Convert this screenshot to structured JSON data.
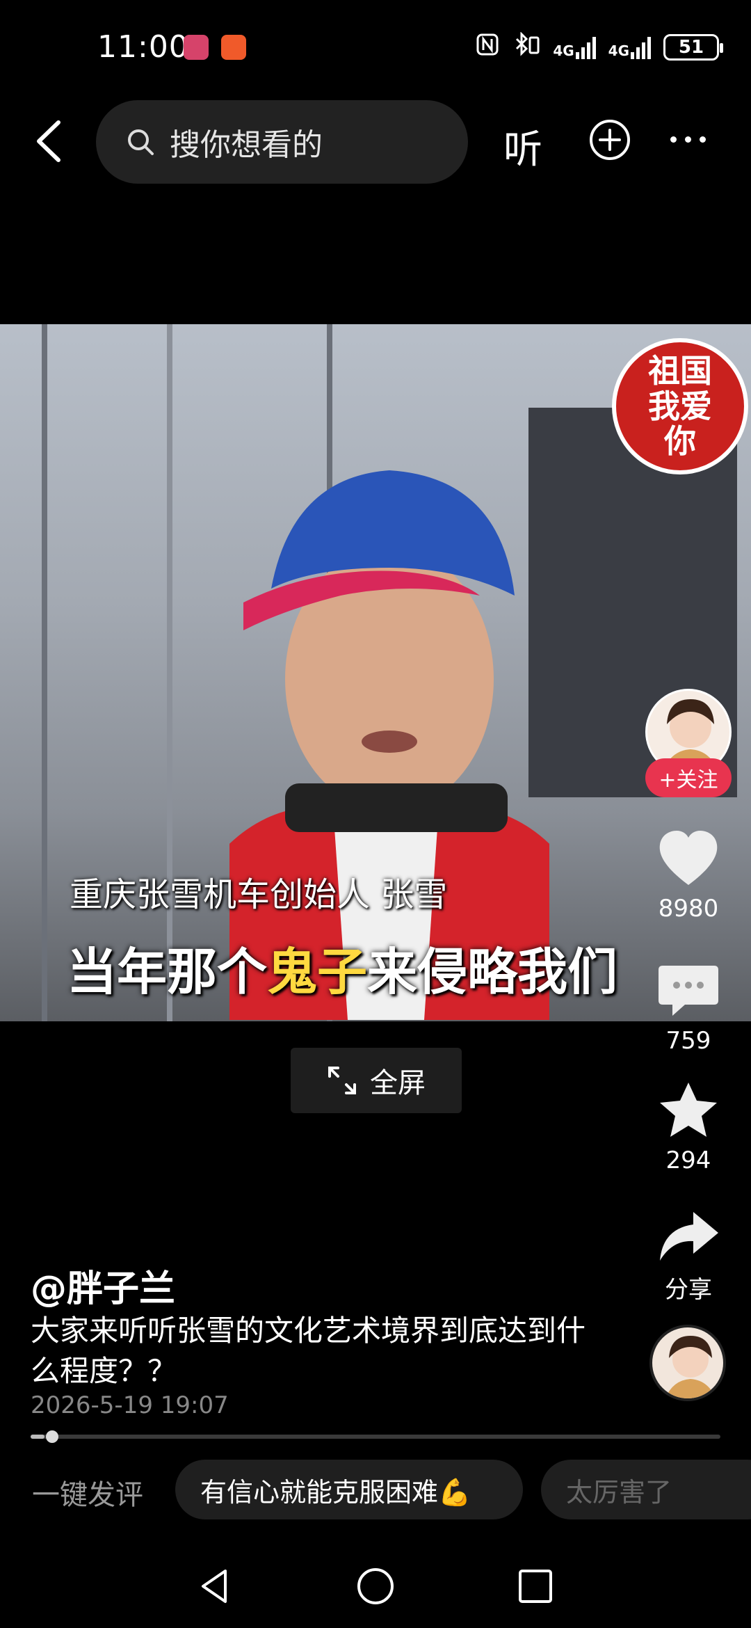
{
  "status_bar": {
    "time": "11:00",
    "network_1": "4G",
    "network_2": "4G",
    "battery": "51"
  },
  "top_nav": {
    "search_placeholder": "搜你想看的",
    "listen_label": "听"
  },
  "video": {
    "stamp_text": "祖国我爱你",
    "caption_name": "重庆张雪机车创始人 张雪",
    "caption_main_before": "当年那个",
    "caption_main_highlight": "鬼子",
    "caption_main_after": "来侵略我们",
    "highlight_color": "#ffd940"
  },
  "fullscreen_label": "全屏",
  "rail": {
    "follow_label": "+关注",
    "likes": "8980",
    "comments": "759",
    "favorites": "294",
    "share_label": "分享"
  },
  "post": {
    "author": "@胖子兰",
    "description": "大家来听听张雪的文化艺术境界到底达到什么程度？？",
    "date": "2026-5-19 19:07",
    "progress": 0.02
  },
  "quick_comment": {
    "label": "一键发评",
    "chips": [
      "有信心就能克服困难💪",
      "太厉害了"
    ]
  },
  "colors": {
    "follow_button": "#e8344f",
    "background": "#000000"
  }
}
